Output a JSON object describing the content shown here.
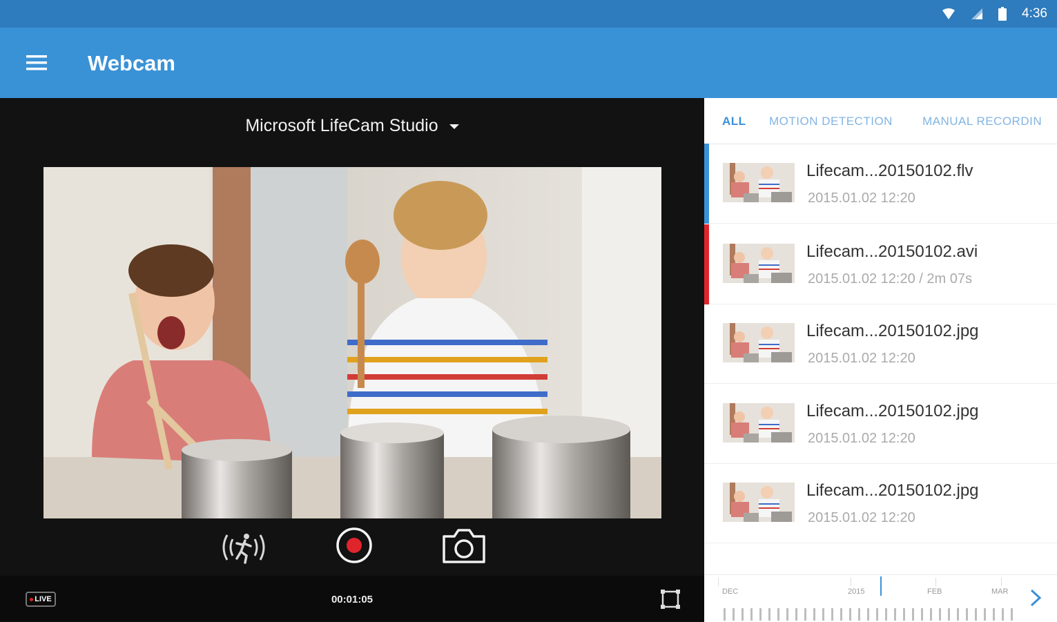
{
  "status_bar": {
    "time": "4:36"
  },
  "app_bar": {
    "title": "Webcam"
  },
  "camera": {
    "name": "Microsoft LifeCam Studio"
  },
  "recording": {
    "live_label": "LIVE",
    "elapsed": "00:01:05"
  },
  "tabs": [
    {
      "label": "ALL",
      "active": true
    },
    {
      "label": "MOTION DETECTION",
      "active": false
    },
    {
      "label": "MANUAL RECORDIN",
      "active": false
    }
  ],
  "files": [
    {
      "name": "Lifecam...20150102.flv",
      "date": "2015.01.02  12:20",
      "duration": "",
      "indicator_color": "#3a92d6"
    },
    {
      "name": "Lifecam...20150102.avi",
      "date": "2015.01.02  12:20",
      "duration": "2m 07s",
      "indicator_color": "#e0242c"
    },
    {
      "name": "Lifecam...20150102.jpg",
      "date": "2015.01.02  12:20",
      "duration": "",
      "indicator_color": ""
    },
    {
      "name": "Lifecam...20150102.jpg",
      "date": "2015.01.02  12:20",
      "duration": "",
      "indicator_color": ""
    },
    {
      "name": "Lifecam...20150102.jpg",
      "date": "2015.01.02  12:20",
      "duration": "",
      "indicator_color": ""
    }
  ],
  "timeline": {
    "labels": [
      "DEC",
      "2015",
      "FEB",
      "MAR"
    ]
  },
  "colors": {
    "status_bar": "#2e7bbd",
    "app_bar": "#3a92d6",
    "accent": "#3a8fd8",
    "record_red": "#e0242c"
  },
  "icons": [
    "menu-icon",
    "wifi-icon",
    "signal-icon",
    "battery-icon",
    "dropdown-caret-icon",
    "motion-detection-icon",
    "record-icon",
    "camera-icon",
    "fullscreen-icon",
    "chevron-right-icon"
  ]
}
